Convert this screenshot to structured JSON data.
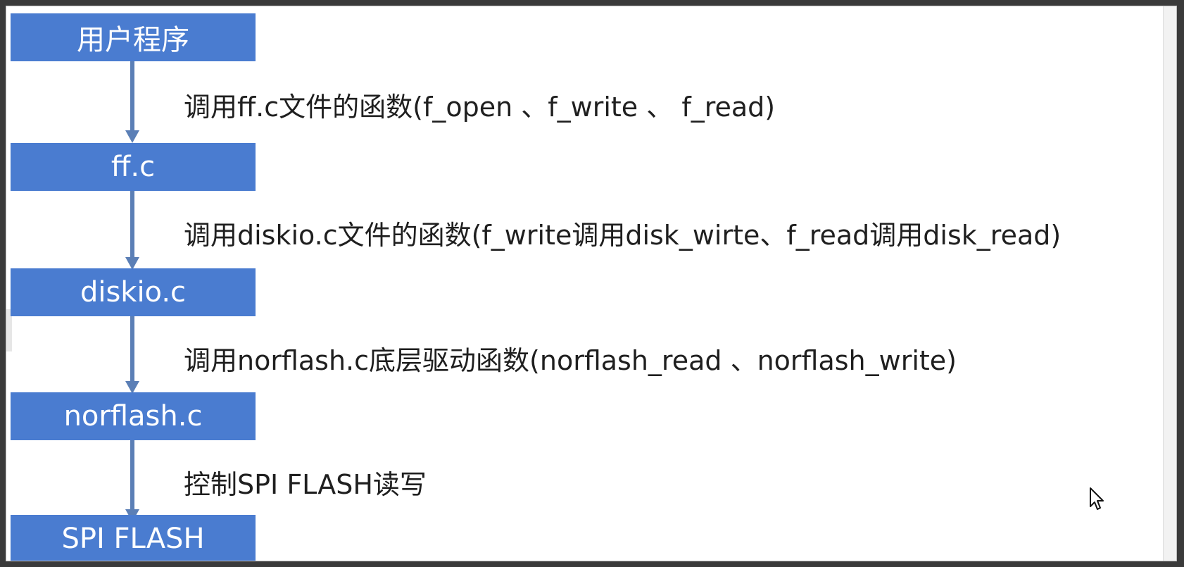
{
  "diagram": {
    "nodes": [
      {
        "id": "user-program",
        "label": "用户程序"
      },
      {
        "id": "ff-c",
        "label": "ff.c"
      },
      {
        "id": "diskio-c",
        "label": "diskio.c"
      },
      {
        "id": "norflash-c",
        "label": "norflash.c"
      },
      {
        "id": "spi-flash",
        "label": "SPI FLASH"
      }
    ],
    "edges": [
      {
        "from": "user-program",
        "to": "ff-c",
        "label": "调用ff.c文件的函数(f_open 、f_write 、 f_read)"
      },
      {
        "from": "ff-c",
        "to": "diskio-c",
        "label": "调用diskio.c文件的函数(f_write调用disk_wirte、f_read调用disk_read)"
      },
      {
        "from": "diskio-c",
        "to": "norflash-c",
        "label": "调用norflash.c底层驱动函数(norflash_read 、norflash_write)"
      },
      {
        "from": "norflash-c",
        "to": "spi-flash",
        "label": "控制SPI FLASH读写"
      }
    ]
  },
  "colors": {
    "box_fill": "#4a7cd0",
    "box_text": "#ffffff",
    "arrow": "#5b7fb6",
    "note_text": "#1f1f1f"
  },
  "icons": {
    "cursor": "cursor-arrow-icon"
  }
}
